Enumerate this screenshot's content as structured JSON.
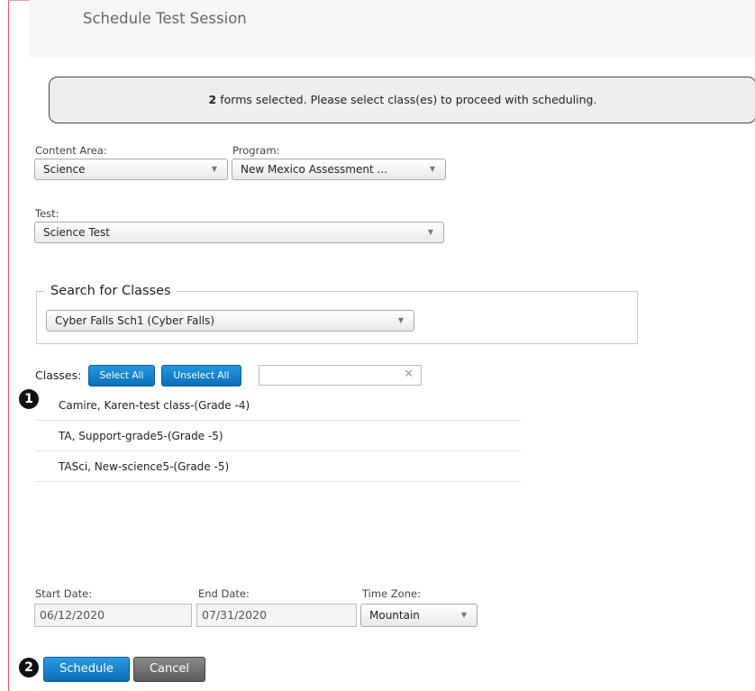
{
  "header": {
    "title": "Schedule Test Session"
  },
  "notice": {
    "count": "2",
    "message": " forms selected. Please select class(es) to proceed with scheduling."
  },
  "content_area": {
    "label": "Content Area:",
    "value": "Science"
  },
  "program": {
    "label": "Program:",
    "value": "New Mexico Assessment ..."
  },
  "test": {
    "label": "Test:",
    "value": "Science Test"
  },
  "search": {
    "legend": "Search for Classes",
    "school": "Cyber Falls Sch1 (Cyber Falls)"
  },
  "classes": {
    "label": "Classes:",
    "select_all": "Select All",
    "unselect_all": "Unselect All",
    "filter_value": "",
    "clear_glyph": "✕",
    "items": [
      {
        "label": "Camire, Karen-test class-(Grade -4)"
      },
      {
        "label": "TA, Support-grade5-(Grade -5)"
      },
      {
        "label": "TASci, New-science5-(Grade -5)"
      }
    ]
  },
  "dates": {
    "start_label": "Start Date:",
    "start_value": "06/12/2020",
    "end_label": "End Date:",
    "end_value": "07/31/2020",
    "tz_label": "Time Zone:",
    "tz_value": "Mountain"
  },
  "actions": {
    "schedule": "Schedule",
    "cancel": "Cancel"
  },
  "callouts": {
    "one": "1",
    "two": "2"
  },
  "icons": {
    "dropdown": "chevron-down-icon",
    "clear": "clear-icon"
  },
  "colors": {
    "primary": "#0b6fb8",
    "cancel": "#5c5c5c",
    "callout": "#111111"
  }
}
